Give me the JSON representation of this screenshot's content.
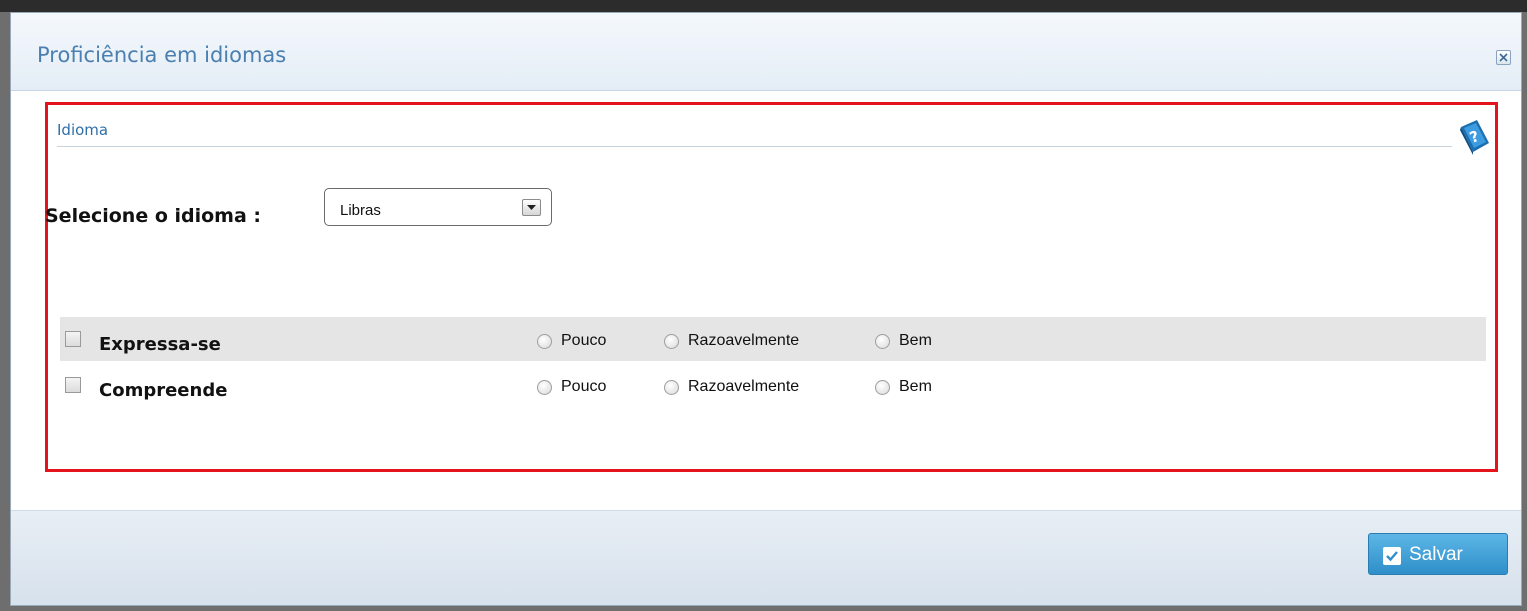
{
  "dialog": {
    "title": "Proficiência em idiomas",
    "close_icon": "close-icon"
  },
  "section": {
    "title": "Idioma",
    "help_icon": "help-book-icon"
  },
  "language": {
    "label": "Selecione o idioma :",
    "selected": "Libras"
  },
  "skills": [
    {
      "label": "Expressa-se",
      "checked": false,
      "options": [
        "Pouco",
        "Razoavelmente",
        "Bem"
      ]
    },
    {
      "label": "Compreende",
      "checked": false,
      "options": [
        "Pouco",
        "Razoavelmente",
        "Bem"
      ]
    }
  ],
  "footer": {
    "save_label": "Salvar",
    "save_icon": "checkmark-icon"
  },
  "colors": {
    "title_text": "#4a7fb0",
    "section_title": "#2f6fa8",
    "highlight_border": "#e3141b",
    "save_button": "#3a9fd8",
    "row_shade": "#e5e5e5"
  }
}
